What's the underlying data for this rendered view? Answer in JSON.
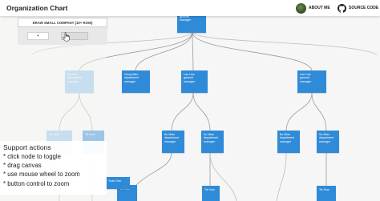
{
  "app": {
    "title": "Organization Chart"
  },
  "nav": {
    "about_label": "ABOUT ME",
    "avatar_icon": "user-avatar",
    "source_label": "SOURCE CODE",
    "source_icon": "github-icon"
  },
  "controls": {
    "draw_label": "DRAW SMALL COMPANY (10+ ROW)",
    "zoom_in_label": "+",
    "zoom_out_label": ""
  },
  "support": {
    "title": "Support actions",
    "items": [
      "* click node to toggle",
      "* drag canvas",
      "* use mouse wheel to zoom",
      "* button control to zoom"
    ]
  },
  "org": {
    "root": [
      "general",
      "manager"
    ],
    "managers": [
      [
        "Bo Miao",
        "department",
        "manager"
      ],
      [
        "Hong Miao",
        "department",
        "manager"
      ],
      [
        "Lan Liao",
        "general",
        "manager"
      ],
      [
        "Lan Liao",
        "general",
        "manager"
      ]
    ],
    "level3": [
      [
        "Tie Hua"
      ],
      [
        "Tie Hua"
      ],
      [
        "Bo Miao",
        "department",
        "manager"
      ],
      [
        "Su Miao",
        "department",
        "manager"
      ],
      [
        "Bo Miao",
        "department",
        "manager"
      ],
      [
        "Su Miao",
        "department",
        "manager"
      ]
    ],
    "level4": [
      [
        "Tie Hua"
      ],
      [
        "Tie Hua"
      ],
      [
        "Tie Hua"
      ]
    ],
    "partial": [
      [
        "Yuan Hua"
      ]
    ]
  },
  "colors": {
    "node": "#2f8bd8",
    "node_faded": "#8ec0ee",
    "link": "#9a9a9a",
    "background": "#f6f6f6"
  }
}
